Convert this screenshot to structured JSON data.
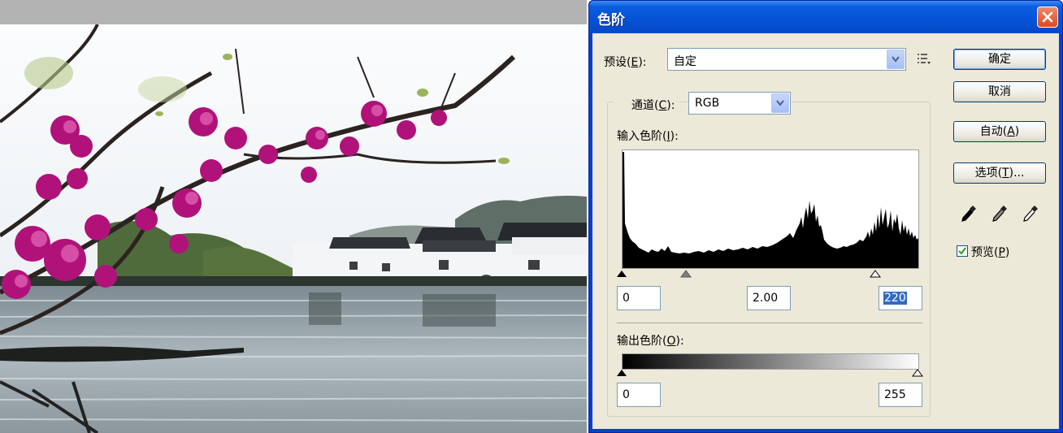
{
  "dialog": {
    "title": "色阶",
    "preset_label_pre": "预设(",
    "preset_label_key": "E",
    "preset_label_post": "):",
    "preset_value": "自定",
    "channel_label_pre": "通道(",
    "channel_label_key": "C",
    "channel_label_post": "):",
    "channel_value": "RGB",
    "input_levels_label_pre": "输入色阶(",
    "input_levels_label_key": "I",
    "input_levels_label_post": "):",
    "input_black": "0",
    "input_gamma": "2.00",
    "input_white": "220",
    "output_levels_label_pre": "输出色阶(",
    "output_levels_label_key": "O",
    "output_levels_label_post": "):",
    "output_black": "0",
    "output_white": "255",
    "buttons": {
      "ok": "确定",
      "cancel": "取消",
      "auto_pre": "自动(",
      "auto_key": "A",
      "auto_post": ")",
      "options_pre": "选项(",
      "options_key": "T",
      "options_post": ")..."
    },
    "preview_label_pre": "预览(",
    "preview_label_key": "P",
    "preview_label_post": ")",
    "preview_checked": true,
    "colors": {
      "title_bar": "#0553d8",
      "dialog_bg": "#ece9d8",
      "close_button": "#d94a22"
    },
    "icons": [
      "preset-menu-icon",
      "black-eyedropper-icon",
      "gray-eyedropper-icon",
      "white-eyedropper-icon",
      "close-icon",
      "checkmark-icon"
    ]
  }
}
